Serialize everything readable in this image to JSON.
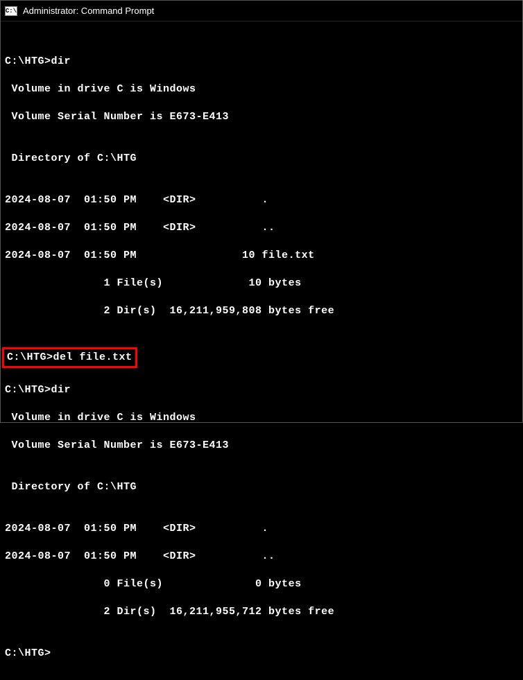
{
  "titlebar": {
    "icon_text": "C:\\",
    "title": "Administrator: Command Prompt"
  },
  "terminal": {
    "blank": "",
    "prompt1": "C:\\HTG>dir",
    "vol1": " Volume in drive C is Windows",
    "serial1": " Volume Serial Number is E673-E413",
    "dirof1": " Directory of C:\\HTG",
    "row1_1": "2024-08-07  01:50 PM    <DIR>          .",
    "row1_2": "2024-08-07  01:50 PM    <DIR>          ..",
    "row1_3": "2024-08-07  01:50 PM                10 file.txt",
    "sum1_1": "               1 File(s)             10 bytes",
    "sum1_2": "               2 Dir(s)  16,211,959,808 bytes free",
    "highlighted": "C:\\HTG>del file.txt",
    "prompt2": "C:\\HTG>dir",
    "vol2": " Volume in drive C is Windows",
    "serial2": " Volume Serial Number is E673-E413",
    "dirof2": " Directory of C:\\HTG",
    "row2_1": "2024-08-07  01:50 PM    <DIR>          .",
    "row2_2": "2024-08-07  01:50 PM    <DIR>          ..",
    "sum2_1": "               0 File(s)              0 bytes",
    "sum2_2": "               2 Dir(s)  16,211,955,712 bytes free",
    "prompt3": "C:\\HTG>"
  }
}
